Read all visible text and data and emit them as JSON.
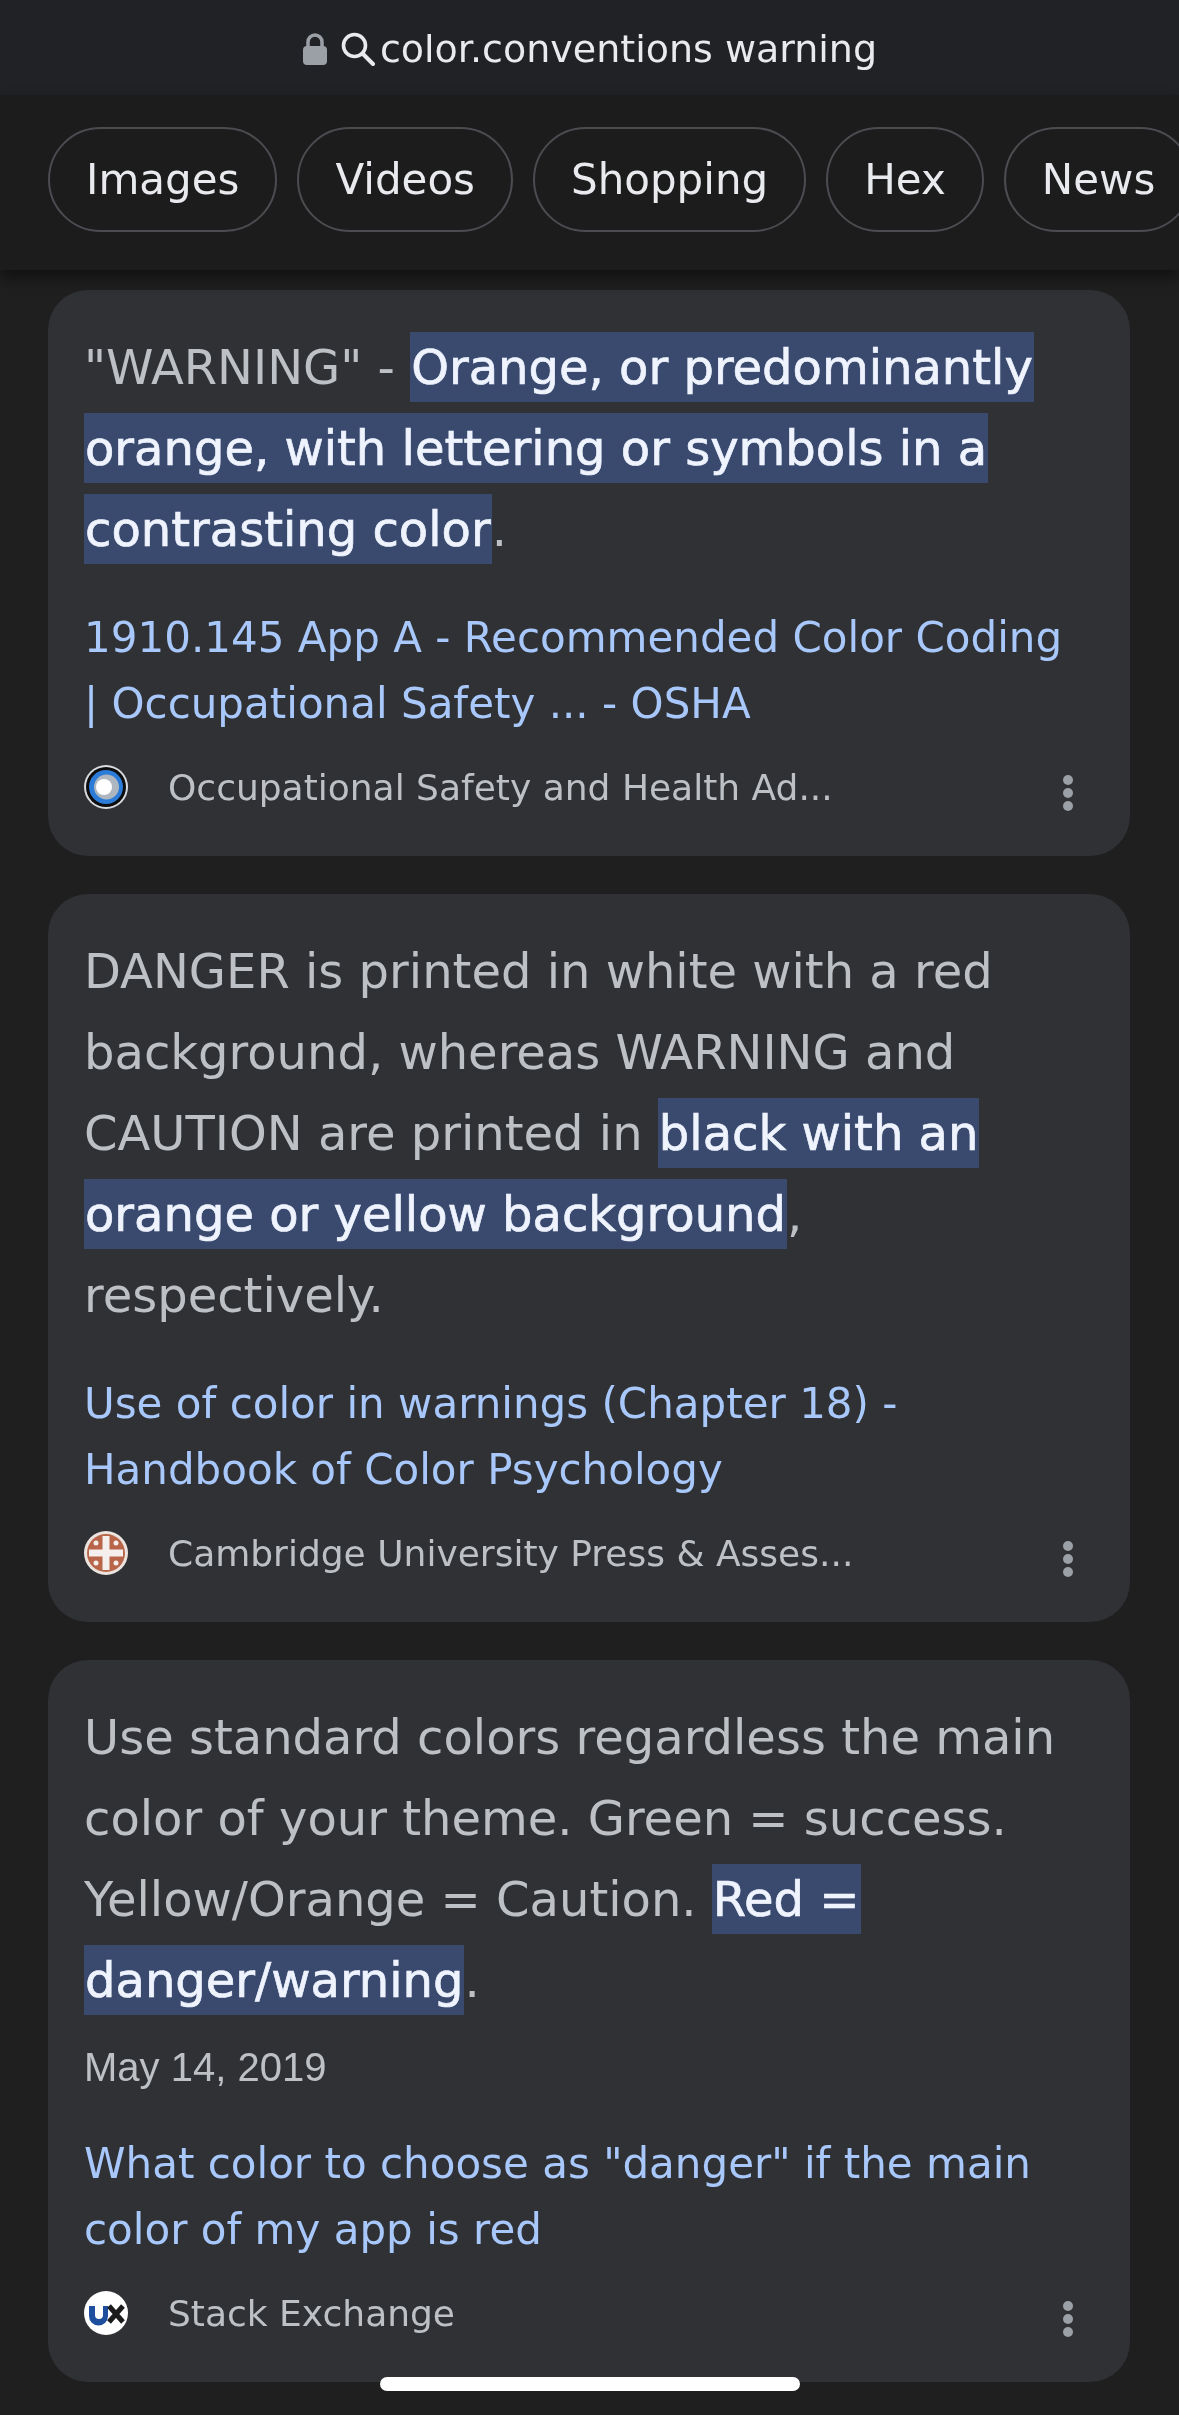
{
  "address_bar": {
    "query": "color.conventions warning"
  },
  "filter_chips": [
    "Images",
    "Videos",
    "Shopping",
    "Hex",
    "News"
  ],
  "results": [
    {
      "snippet": "\"WARNING\" - **Orange, or predominantly orange, with lettering or symbols in a contrasting color**.",
      "title": "1910.145 App A - Recommended Color Coding | Occupational Safety ... - OSHA",
      "source": "Occupational Safety and Health Ad..."
    },
    {
      "snippet": "DANGER is printed in white with a red background, whereas WARNING and CAUTION are printed in **black with an orange or yellow background**, respectively.",
      "title": "Use of color in warnings (Chapter 18) - Handbook of Color Psychology",
      "source": "Cambridge University Press & Asses..."
    },
    {
      "snippet": "Use standard colors regardless the main color of your theme. Green = success. Yellow/Orange = Caution. **Red = danger/warning**.",
      "date": "May 14, 2019",
      "title": "What color to choose as \"danger\" if the main color of my app is red",
      "source": "Stack Exchange"
    }
  ]
}
